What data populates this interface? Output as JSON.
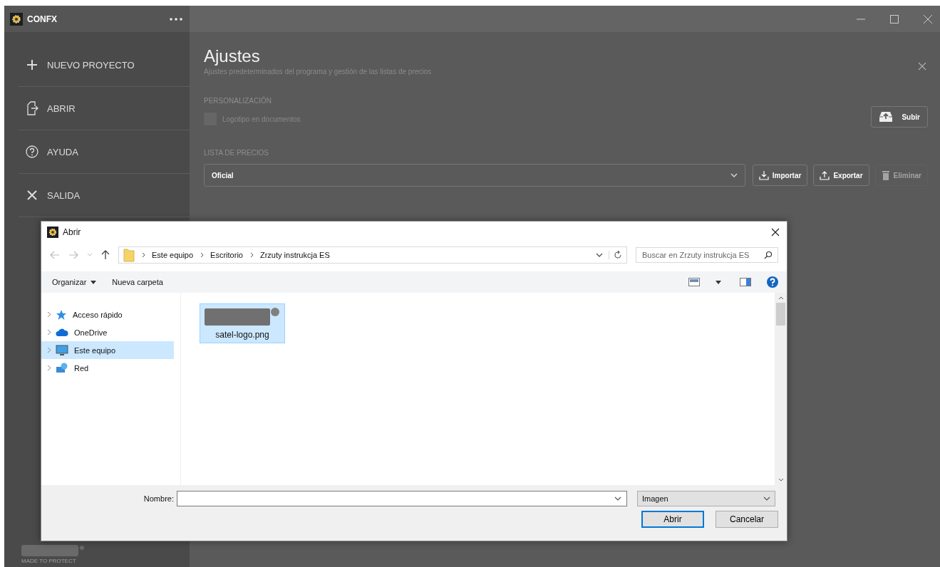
{
  "app": {
    "title": "CONFX"
  },
  "sidebar": {
    "items": [
      {
        "kind": "new",
        "label": "NUEVO PROYECTO"
      },
      {
        "kind": "open",
        "label": "ABRIR"
      },
      {
        "kind": "help",
        "label": "AYUDA"
      },
      {
        "kind": "exit",
        "label": "SALIDA"
      }
    ],
    "tagline": "MADE TO PROTECT"
  },
  "settings": {
    "title": "Ajustes",
    "subtitle": "Ajustes predeterminados del programa y gestión de las listas de precios",
    "personalization": {
      "heading": "PERSONALIZACIÓN",
      "logo_option": {
        "label": "Logotipo en documentos",
        "checked": false,
        "disabled": true
      },
      "upload_button": "Subir"
    },
    "price_list": {
      "heading": "LISTA DE PRECIOS",
      "value": "Oficial",
      "buttons": [
        {
          "kind": "import",
          "label": "Importar",
          "disabled": false
        },
        {
          "kind": "export",
          "label": "Exportar",
          "disabled": false
        },
        {
          "kind": "delete",
          "label": "Eliminar",
          "disabled": true
        }
      ]
    }
  },
  "dialog": {
    "title": "Abrir",
    "path": [
      "Este equipo",
      "Escritorio",
      "Zrzuty instrukcja ES"
    ],
    "search": {
      "placeholder": "Buscar en Zrzuty instrukcja ES"
    },
    "toolbar": [
      "Organizar",
      "Nueva carpeta"
    ],
    "nav_items": [
      {
        "kind": "star",
        "label": "Acceso rápido",
        "selected": false
      },
      {
        "kind": "cloud",
        "label": "OneDrive",
        "selected": false
      },
      {
        "kind": "computer",
        "label": "Este equipo",
        "selected": true
      },
      {
        "kind": "network",
        "label": "Red",
        "selected": false
      }
    ],
    "files": [
      {
        "name": "satel-logo.png",
        "selected": true
      }
    ],
    "filename_label": "Nombre:",
    "file_type": "Imagen",
    "buttons": [
      "Abrir",
      "Cancelar"
    ]
  }
}
